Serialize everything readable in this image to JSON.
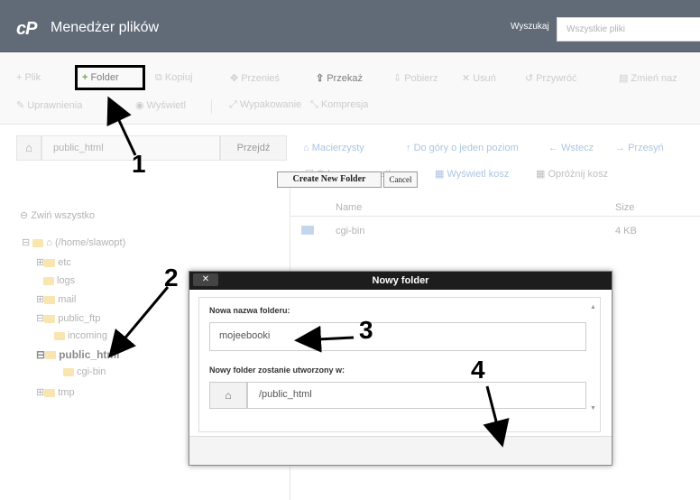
{
  "header": {
    "logo": "cP",
    "title": "Menedżer plików",
    "search_label": "Wyszukaj",
    "search_placeholder": "Wszystkie pliki"
  },
  "toolbar": {
    "row1": [
      {
        "icon": "+",
        "label": "Plik"
      },
      {
        "icon": "+",
        "label": "Folder"
      },
      {
        "icon": "⧉",
        "label": "Kopiuj"
      },
      {
        "icon": "✥",
        "label": "Przenieś"
      },
      {
        "icon": "⇪",
        "label": "Przekaż"
      },
      {
        "icon": "⇩",
        "label": "Pobierz"
      },
      {
        "icon": "✕",
        "label": "Usuń"
      },
      {
        "icon": "↺",
        "label": "Przywróć"
      },
      {
        "icon": "▤",
        "label": "Zmień naz"
      }
    ],
    "row2": [
      {
        "icon": "✎",
        "label": "Uprawnienia"
      },
      {
        "icon": "◉",
        "label": "Wyświetl"
      },
      {
        "icon": "⤢",
        "label": "Wypakowanie"
      },
      {
        "icon": "⤡",
        "label": "Kompresja"
      }
    ]
  },
  "path_bar": {
    "home_icon": "home-icon",
    "path": "public_html",
    "go_label": "Przejdź"
  },
  "tree": {
    "collapse_all": "Zwiń wszystko",
    "root": "(/home/slawopt)",
    "items": [
      "etc",
      "logs",
      "mail",
      "public_ftp",
      "incoming",
      "public_html",
      "cgi-bin",
      "tmp"
    ]
  },
  "nav": {
    "home": "Macierzysty",
    "up": "Do góry o jeden poziom",
    "back": "Wstecz",
    "forward": "Przesyń",
    "deselect": "Odznacz wszystko",
    "show_trash": "Wyświetl kosz",
    "empty_trash": "Opróżnij kosz"
  },
  "file_table": {
    "columns": [
      "Name",
      "Size"
    ],
    "rows": [
      {
        "name": "cgi-bin",
        "size": "4 KB"
      }
    ]
  },
  "dialog": {
    "title": "Nowy folder",
    "close": "✕",
    "name_label": "Nowa nazwa folderu:",
    "name_value": "mojeebooki",
    "location_label": "Nowy folder zostanie utworzony w:",
    "location_value": "/public_html",
    "create_label": "Create New Folder",
    "cancel_label": "Cancel"
  },
  "annotations": [
    "1",
    "2",
    "3",
    "4"
  ]
}
